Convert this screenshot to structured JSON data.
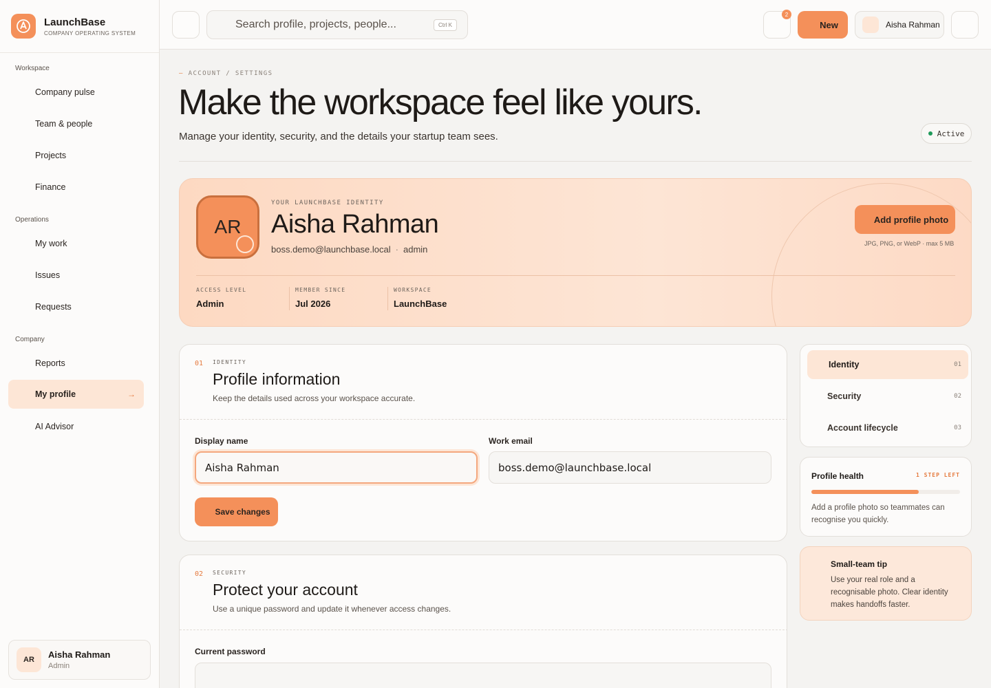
{
  "brand": {
    "name": "LaunchBase",
    "tagline": "COMPANY OPERATING SYSTEM",
    "accent": "#f4905a"
  },
  "sidebar": {
    "groups": [
      {
        "label": "Workspace",
        "items": [
          "Company pulse",
          "Team & people",
          "Projects",
          "Finance"
        ]
      },
      {
        "label": "Operations",
        "items": [
          "My work",
          "Issues",
          "Requests"
        ]
      },
      {
        "label": "Company",
        "items": [
          "Reports",
          "My profile",
          "AI Advisor"
        ]
      }
    ],
    "active_item": "My profile",
    "active_arrow": "→",
    "user": {
      "initials": "AR",
      "name": "Aisha Rahman",
      "role": "Admin"
    }
  },
  "topbar": {
    "search_placeholder": "Search profile, projects, people...",
    "search_shortcut": "Ctrl K",
    "notification_count": "2",
    "new_label": "New",
    "user_name": "Aisha Rahman"
  },
  "page": {
    "breadcrumb_dash": "—",
    "breadcrumb": "ACCOUNT / SETTINGS",
    "title": "Make the workspace feel like yours.",
    "subtitle": "Manage your identity, security, and the details your startup team sees.",
    "status": "Active",
    "status_color": "#1f9a5a"
  },
  "hero": {
    "initials": "AR",
    "label": "YOUR LAUNCHBASE IDENTITY",
    "name": "Aisha Rahman",
    "email": "boss.demo@launchbase.local",
    "meta_sep": "·",
    "role": "admin",
    "photo_button": "Add profile photo",
    "photo_hint": "JPG, PNG, or WebP · max 5 MB",
    "stats": [
      {
        "label": "ACCESS LEVEL",
        "value": "Admin"
      },
      {
        "label": "MEMBER SINCE",
        "value": "Jul 2026"
      },
      {
        "label": "WORKSPACE",
        "value": "LaunchBase"
      }
    ]
  },
  "identity_card": {
    "num": "01",
    "kicker": "IDENTITY",
    "title": "Profile information",
    "desc": "Keep the details used across your workspace accurate.",
    "display_name_label": "Display name",
    "display_name_value": "Aisha Rahman",
    "email_label": "Work email",
    "email_value": "boss.demo@launchbase.local",
    "save_label": "Save changes"
  },
  "security_card": {
    "num": "02",
    "kicker": "SECURITY",
    "title": "Protect your account",
    "desc": "Use a unique password and update it whenever access changes.",
    "current_password_label": "Current password",
    "current_password_value": ""
  },
  "section_nav": [
    {
      "label": "Identity",
      "num": "01",
      "active": true
    },
    {
      "label": "Security",
      "num": "02"
    },
    {
      "label": "Account lifecycle",
      "num": "03"
    }
  ],
  "profile_health": {
    "title": "Profile health",
    "step": "1 STEP LEFT",
    "progress": 0.72,
    "text": "Add a profile photo so teammates can recognise you quickly."
  },
  "tip": {
    "title": "Small-team tip",
    "text": "Use your real role and a recognisable photo. Clear identity makes handoffs faster."
  }
}
